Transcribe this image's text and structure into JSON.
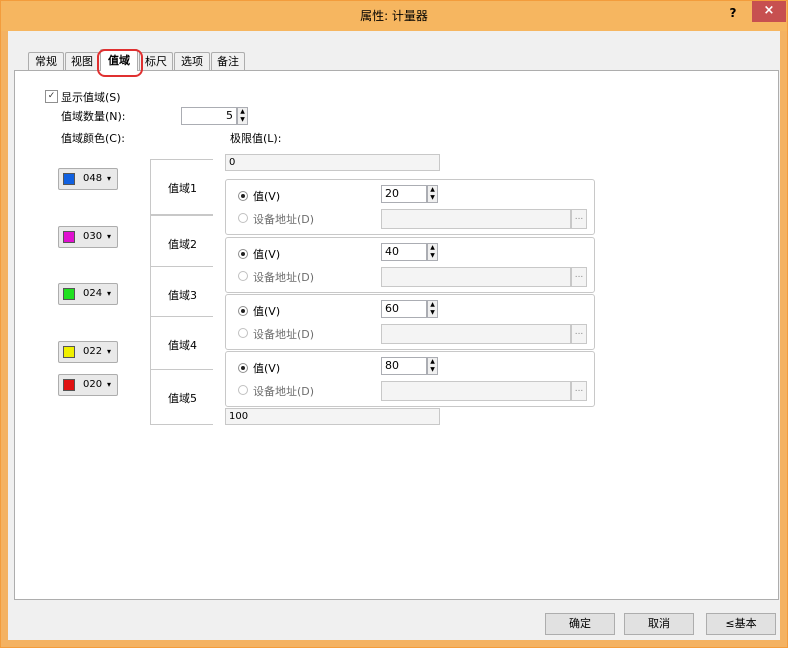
{
  "window": {
    "title": "属性: 计量器",
    "help_label": "?",
    "close_label": "×"
  },
  "tabs": [
    {
      "label": "常规"
    },
    {
      "label": "视图"
    },
    {
      "label": "值域"
    },
    {
      "label": "标尺"
    },
    {
      "label": "选项"
    },
    {
      "label": "备注"
    }
  ],
  "active_tab": "值域",
  "range_panel": {
    "show_range_label": "显示值域(S)",
    "show_range_checked": true,
    "range_count_label": "值域数量(N):",
    "range_count_value": "5",
    "range_color_label": "值域颜色(C):",
    "limit_label": "极限值(L):",
    "limit_min": "0",
    "limit_max": "100",
    "zones": [
      {
        "color_code": "048",
        "color": "#1060e0",
        "name": "值域1",
        "value_label": "值(V)",
        "address_label": "设备地址(D)",
        "value": "20",
        "value_selected": true
      },
      {
        "color_code": "030",
        "color": "#e010d0",
        "name": "值域2",
        "value_label": "值(V)",
        "address_label": "设备地址(D)",
        "value": "40",
        "value_selected": true
      },
      {
        "color_code": "024",
        "color": "#20e020",
        "name": "值域3",
        "value_label": "值(V)",
        "address_label": "设备地址(D)",
        "value": "60",
        "value_selected": true
      },
      {
        "color_code": "022",
        "color": "#f0f000",
        "name": "值域4",
        "value_label": "值(V)",
        "address_label": "设备地址(D)",
        "value": "80",
        "value_selected": true
      },
      {
        "color_code": "020",
        "color": "#e01010",
        "name": "值域5",
        "value_label": "",
        "address_label": "",
        "value": "",
        "value_selected": false
      }
    ],
    "browse_label": "..."
  },
  "buttons": {
    "ok": "确定",
    "cancel": "取消",
    "basic": "≤基本"
  }
}
